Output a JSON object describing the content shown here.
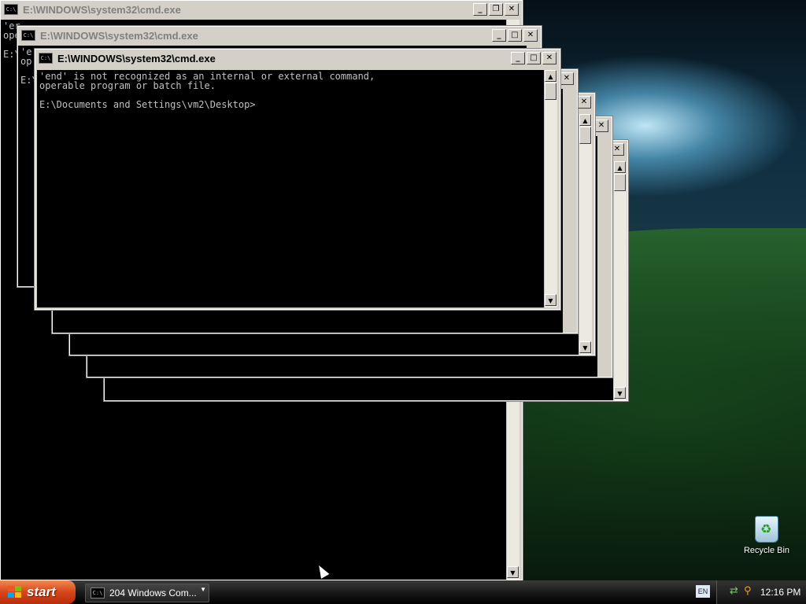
{
  "desktop": {
    "recycle_bin_label": "Recycle Bin"
  },
  "windows": {
    "title": "E:\\WINDOWS\\system32\\cmd.exe",
    "icon_label": "C:\\",
    "minimize_glyph": "_",
    "maximize_glyph": "□",
    "restore_glyph": "❐",
    "close_glyph": "✕"
  },
  "back_window": {
    "lines": "'er\nope\n\nE:\\"
  },
  "mid_window": {
    "lines": "'e\nop\n\nE:\\"
  },
  "front_window": {
    "lines": "'end' is not recognized as an internal or external command,\noperable program or batch file.\n\nE:\\Documents and Settings\\vm2\\Desktop>"
  },
  "scroll": {
    "up": "▲",
    "down": "▼"
  },
  "taskbar": {
    "start_label": "start",
    "task_button_label": "204 Windows Com...",
    "task_button_arrow": "▼",
    "language": "EN",
    "clock": "12:16 PM",
    "tray_icons": [
      "network-icon",
      "search-icon"
    ]
  },
  "colors": {
    "console_bg": "#000000",
    "console_text": "#c0c0c0",
    "window_frame": "#d4d0c8",
    "start_button": "#d7441a"
  }
}
